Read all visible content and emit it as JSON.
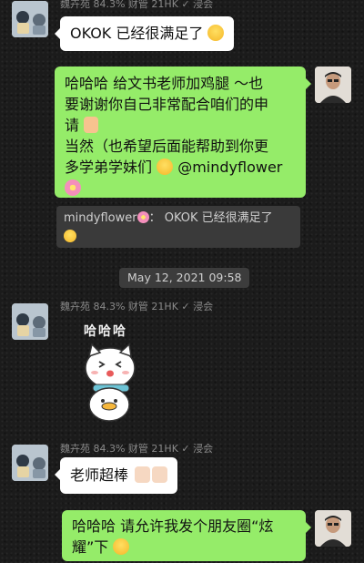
{
  "messages": {
    "msg1": {
      "sender": "魏卉苑 84.3% 财管 21HK ✓ 浸会",
      "text": "OKOK 已经很满足了"
    },
    "msg2": {
      "lines": [
        "哈哈哈 给文书老师加鸡腿 ～也",
        "要谢谢你自己非常配合咱们的申",
        "请",
        "当然（也希望后面能帮助到你更",
        "多学弟学妹们",
        "@mindyflower"
      ]
    },
    "quote": {
      "author": "mindyflower",
      "sep": "：",
      "text": "OKOK 已经很满足了"
    },
    "timestamp": "May 12, 2021 09:58",
    "msg3": {
      "sender": "魏卉苑 84.3% 财管 21HK ✓ 浸会",
      "sticker_text": "哈哈哈"
    },
    "msg4": {
      "sender": "魏卉苑 84.3% 财管 21HK ✓ 浸会",
      "text": "老师超棒"
    },
    "msg5": {
      "lines": [
        "哈哈哈 请允许我发个朋友圈“炫",
        "耀”下"
      ]
    }
  },
  "icons": {
    "smile": "smiling-face-icon",
    "handshake": "handshake-icon",
    "grin": "grinning-face-icon",
    "flower": "cherry-blossom-icon",
    "thumbs": "thumbs-up-icon",
    "verified": "verified-check-icon"
  },
  "colors": {
    "bubble_green": "#95ec69",
    "bubble_white": "#ffffff",
    "background": "#1b1b1b"
  }
}
